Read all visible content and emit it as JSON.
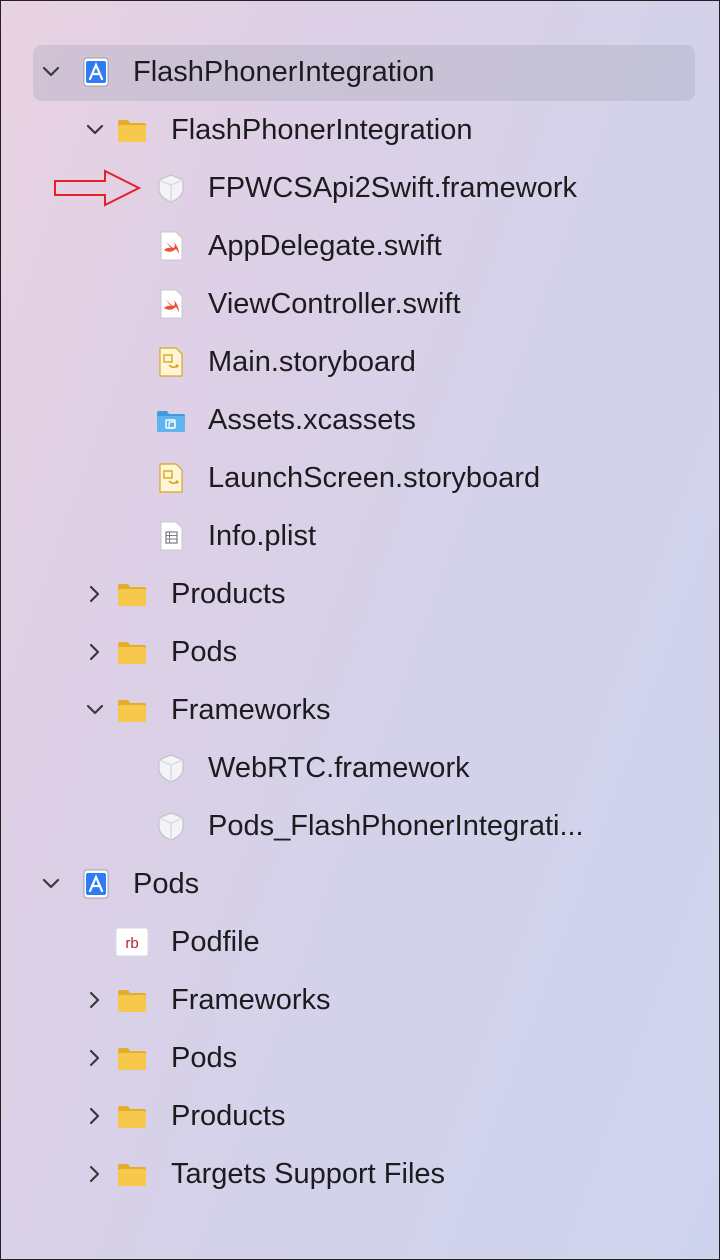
{
  "colors": {
    "folder": "#f6c94c",
    "project": "#2f7cf6",
    "swift": "#f05138",
    "arrow": "#e8202a"
  },
  "tree": [
    {
      "key": "row-project-flashphoner",
      "label": "FlashPhonerIntegration",
      "icon": "xcode-project-icon",
      "level": 0,
      "chevron": "down",
      "selected": true
    },
    {
      "key": "row-group-flashphoner",
      "label": "FlashPhonerIntegration",
      "icon": "folder-icon",
      "level": 1,
      "chevron": "down"
    },
    {
      "key": "row-fpwcs-framework",
      "label": "FPWCSApi2Swift.framework",
      "icon": "framework-icon",
      "level": 2
    },
    {
      "key": "row-appdelegate",
      "label": "AppDelegate.swift",
      "icon": "swift-file-icon",
      "level": 2
    },
    {
      "key": "row-viewcontroller",
      "label": "ViewController.swift",
      "icon": "swift-file-icon",
      "level": 2
    },
    {
      "key": "row-main-storyboard",
      "label": "Main.storyboard",
      "icon": "storyboard-icon",
      "level": 2
    },
    {
      "key": "row-assets",
      "label": "Assets.xcassets",
      "icon": "asset-catalog-icon",
      "level": 2
    },
    {
      "key": "row-launchscreen",
      "label": "LaunchScreen.storyboard",
      "icon": "storyboard-icon",
      "level": 2
    },
    {
      "key": "row-info-plist",
      "label": "Info.plist",
      "icon": "plist-icon",
      "level": 2
    },
    {
      "key": "row-products-1",
      "label": "Products",
      "icon": "folder-icon",
      "level": 1,
      "chevron": "right"
    },
    {
      "key": "row-pods-1",
      "label": "Pods",
      "icon": "folder-icon",
      "level": 1,
      "chevron": "right"
    },
    {
      "key": "row-frameworks-1",
      "label": "Frameworks",
      "icon": "folder-icon",
      "level": 1,
      "chevron": "down"
    },
    {
      "key": "row-webrtc",
      "label": "WebRTC.framework",
      "icon": "framework-icon",
      "level": 2
    },
    {
      "key": "row-pods-framework",
      "label": "Pods_FlashPhonerIntegrati...",
      "icon": "framework-icon",
      "level": 2
    },
    {
      "key": "row-project-pods",
      "label": "Pods",
      "icon": "xcode-project-icon",
      "level": 0,
      "chevron": "down"
    },
    {
      "key": "row-podfile",
      "label": "Podfile",
      "icon": "ruby-file-icon",
      "level": "1b",
      "icon_text": "rb"
    },
    {
      "key": "row-frameworks-2",
      "label": "Frameworks",
      "icon": "folder-icon",
      "level": 1,
      "chevron": "right"
    },
    {
      "key": "row-pods-2",
      "label": "Pods",
      "icon": "folder-icon",
      "level": 1,
      "chevron": "right"
    },
    {
      "key": "row-products-2",
      "label": "Products",
      "icon": "folder-icon",
      "level": 1,
      "chevron": "right"
    },
    {
      "key": "row-targets-support",
      "label": "Targets Support Files",
      "icon": "folder-icon",
      "level": 1,
      "chevron": "right"
    }
  ]
}
